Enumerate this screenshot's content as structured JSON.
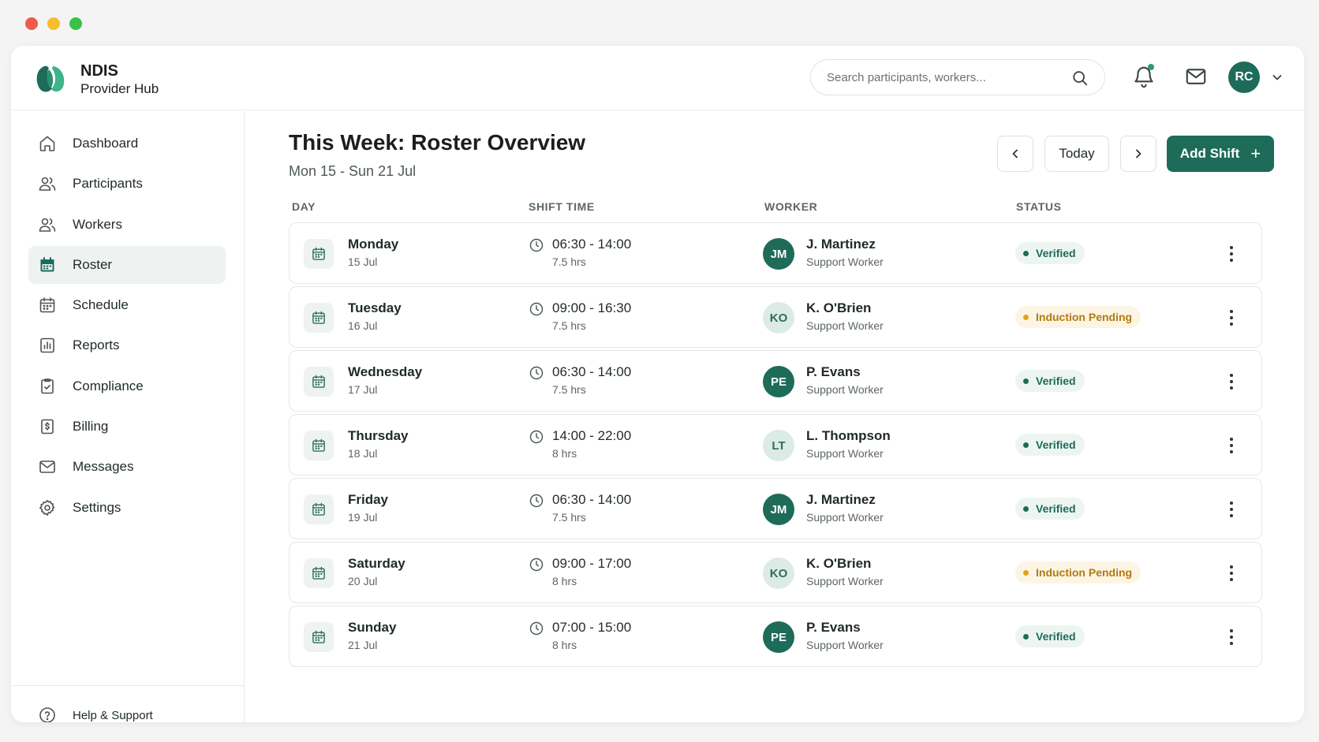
{
  "app": {
    "brand_title": "NDIS",
    "brand_subtitle": "Provider Hub",
    "accent": "#1e6b5a"
  },
  "header": {
    "search_placeholder": "Search participants, workers...",
    "user_initials": "RC"
  },
  "sidebar": {
    "items": [
      {
        "label": "Dashboard",
        "icon": "home-icon"
      },
      {
        "label": "Participants",
        "icon": "users-icon"
      },
      {
        "label": "Workers",
        "icon": "users-icon"
      },
      {
        "label": "Roster",
        "icon": "calendar-icon",
        "active": true
      },
      {
        "label": "Schedule",
        "icon": "calendar-icon"
      },
      {
        "label": "Reports",
        "icon": "bar-chart-icon"
      },
      {
        "label": "Compliance",
        "icon": "shield-check-icon"
      },
      {
        "label": "Billing",
        "icon": "dollar-file-icon"
      },
      {
        "label": "Messages",
        "icon": "mail-icon"
      },
      {
        "label": "Settings",
        "icon": "gear-icon"
      }
    ],
    "help_label": "Help & Support"
  },
  "main": {
    "title": "This Week: Roster Overview",
    "date_range": "Mon 15 - Sun 21 Jul",
    "today_label": "Today",
    "add_shift_label": "Add Shift",
    "columns": [
      "DAY",
      "SHIFT TIME",
      "WORKER",
      "STATUS"
    ],
    "rows": [
      {
        "day": "Monday",
        "date": "15 Jul",
        "time": "06:30 - 14:00",
        "hours": "7.5 hrs",
        "initials": "JM",
        "worker": "J. Martinez",
        "role": "Support Worker",
        "status": "Verified"
      },
      {
        "day": "Tuesday",
        "date": "16 Jul",
        "time": "09:00 - 16:30",
        "hours": "7.5 hrs",
        "initials": "KO",
        "worker": "K. O'Brien",
        "role": "Support Worker",
        "status": "Induction Pending"
      },
      {
        "day": "Wednesday",
        "date": "17 Jul",
        "time": "06:30 - 14:00",
        "hours": "7.5 hrs",
        "initials": "PE",
        "worker": "P. Evans",
        "role": "Support Worker",
        "status": "Verified"
      },
      {
        "day": "Thursday",
        "date": "18 Jul",
        "time": "14:00 - 22:00",
        "hours": "8 hrs",
        "initials": "LT",
        "worker": "L. Thompson",
        "role": "Support Worker",
        "status": "Verified"
      },
      {
        "day": "Friday",
        "date": "19 Jul",
        "time": "06:30 - 14:00",
        "hours": "7.5 hrs",
        "initials": "JM",
        "worker": "J. Martinez",
        "role": "Support Worker",
        "status": "Verified"
      },
      {
        "day": "Saturday",
        "date": "20 Jul",
        "time": "09:00 - 17:00",
        "hours": "8 hrs",
        "initials": "KO",
        "worker": "K. O'Brien",
        "role": "Support Worker",
        "status": "Induction Pending"
      },
      {
        "day": "Sunday",
        "date": "21 Jul",
        "time": "07:00 - 15:00",
        "hours": "8 hrs",
        "initials": "PE",
        "worker": "P. Evans",
        "role": "Support Worker",
        "status": "Verified"
      }
    ]
  }
}
